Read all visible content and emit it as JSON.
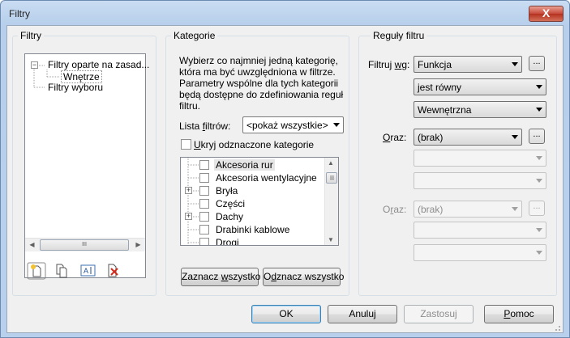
{
  "window": {
    "title": "Filtry",
    "close_label": "X"
  },
  "filters_panel": {
    "group_title": "Filtry",
    "tree": {
      "root_label": "Filtry oparte na zasad...",
      "child_label": "Wnętrze",
      "selection_label": "Filtry wyboru"
    },
    "scroll_thumb": "III",
    "toolbar": [
      "new-filter-icon",
      "duplicate-filter-icon",
      "rename-filter-icon",
      "delete-filter-icon"
    ]
  },
  "categories_panel": {
    "group_title": "Kategorie",
    "instructions": "Wybierz co najmniej jedną kategorię, która ma być uwzględniona w filtrze. Parametry wspólne dla tych kategorii będą dostępne do zdefiniowania reguł filtru.",
    "filter_list": {
      "label_pre": "Lista ",
      "label_u": "f",
      "label_post": "iltrów:",
      "value": "<pokaż wszystkie>"
    },
    "hide_unchecked": {
      "label_pre": "",
      "label_u": "U",
      "label_post": "kryj odznaczone kategorie",
      "checked": false
    },
    "items": [
      {
        "label": "Akcesoria rur",
        "checked": false,
        "expandable": false,
        "highlighted": true
      },
      {
        "label": "Akcesoria wentylacyjne",
        "checked": false,
        "expandable": false,
        "highlighted": false
      },
      {
        "label": "Bryła",
        "checked": false,
        "expandable": true,
        "highlighted": false
      },
      {
        "label": "Części",
        "checked": false,
        "expandable": false,
        "highlighted": false
      },
      {
        "label": "Dachy",
        "checked": false,
        "expandable": true,
        "highlighted": false
      },
      {
        "label": "Drabinki kablowe",
        "checked": false,
        "expandable": false,
        "highlighted": false
      },
      {
        "label": "Drogi",
        "checked": false,
        "expandable": false,
        "highlighted": false
      }
    ],
    "scroll_thumb": "III",
    "check_all": {
      "pre": "Zaznacz ",
      "u": "w",
      "post": "szystko"
    },
    "uncheck_all": {
      "pre": "O",
      "u": "d",
      "post": "znacz wszystko"
    }
  },
  "rules_panel": {
    "group_title": "Reguły filtru",
    "filter_by": {
      "label_pre": "Filtruj ",
      "label_u": "w",
      "label_post": "g:",
      "value": "Funkcja",
      "operator": "jest równy",
      "rule_value": "Wewnętrzna"
    },
    "and1": {
      "label_pre": "",
      "label_u": "O",
      "label_post": "raz:",
      "value": "(brak)"
    },
    "and2": {
      "label_pre": "O",
      "label_u": "r",
      "label_post": "az:",
      "value": "(brak)"
    },
    "dots": "..."
  },
  "buttons": {
    "ok": "OK",
    "cancel": "Anuluj",
    "apply": "Zastosuj",
    "help_u": "P",
    "help_post": "omoc"
  },
  "colors": {
    "accent": "#3c7fb1",
    "close": "#c7493a"
  }
}
